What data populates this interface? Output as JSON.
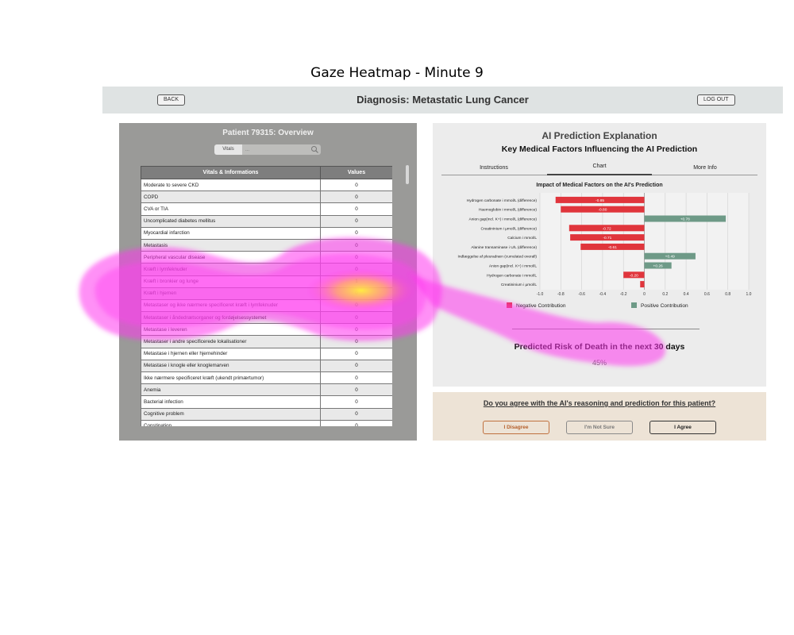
{
  "figure_title": "Gaze Heatmap - Minute 9",
  "header": {
    "back_label": "BACK",
    "title": "Diagnosis: Metastatic Lung Cancer",
    "logout_label": "LOG OUT"
  },
  "left": {
    "title": "Patient 79315: Overview",
    "search_tab": "Vitals",
    "search_placeholder": "...",
    "columns": [
      "Vitals & Informations",
      "Values"
    ],
    "rows": [
      [
        "Moderate to severe CKD",
        "0"
      ],
      [
        "COPD",
        "0"
      ],
      [
        "CVA or TIA",
        "0"
      ],
      [
        "Uncomplicated diabetes mellitus",
        "0"
      ],
      [
        "Myocardial infarction",
        "0"
      ],
      [
        "Metastasis",
        "0"
      ],
      [
        "Peripheral vascular disease",
        "0"
      ],
      [
        "Kræft i lymfeknuder",
        "0"
      ],
      [
        "Kræft i bronkier og lunge",
        "1"
      ],
      [
        "Kræft i hjernen",
        "0"
      ],
      [
        "Metastaser og ikke nærmere specificeret kræft i lymfeknuder",
        "0"
      ],
      [
        "Metastaser i åndedrætsorganer og fordøjelsessystemet",
        "0"
      ],
      [
        "Metastase i leveren",
        "0"
      ],
      [
        "Metastaser i andre specificerede lokalisationer",
        "0"
      ],
      [
        "Metastase i hjernen eller hjernehinder",
        "0"
      ],
      [
        "Metastase i knogle eller knoglemarven",
        "0"
      ],
      [
        "Ikke nærmere specificeret kræft (ukendt primærtumor)",
        "0"
      ],
      [
        "Anemia",
        "0"
      ],
      [
        "Bacterial infection",
        "0"
      ],
      [
        "Cognitive problem",
        "0"
      ],
      [
        "Constipation",
        "0"
      ]
    ]
  },
  "right": {
    "title": "AI Prediction Explanation",
    "subtitle": "Key Medical Factors Influencing the AI Prediction",
    "tabs": [
      "Instructions",
      "Chart",
      "More Info"
    ],
    "active_tab": "Chart",
    "risk_label": "Predicted Risk of Death in the next 30 days",
    "risk_value": "45%"
  },
  "question": {
    "text": "Do you agree with the AI's reasoning and prediction for this patient?",
    "disagree": "I Disagree",
    "not_sure": "I'm Not Sure",
    "agree": "I Agree"
  },
  "chart_data": {
    "type": "bar",
    "orientation": "horizontal",
    "title": "Impact of Medical Factors on the AI's Prediction",
    "categories": [
      "Hydrogen carbonate i mmol/L (difference)",
      "Haemoglobin i mmol/L (difference)",
      "Anion gap(incl. K+) i mmol/L (difference)",
      "Creatininium i µmol/L (difference)",
      "Calcium i mmol/L",
      "Alanine transaminase i U/L (difference)",
      "Indlæggelse af pleuradræn (cumulated overall)",
      "Anion gap(incl. K+) i mmol/L",
      "Hydrogen carbonate i mmol/L",
      "Creatininium i µmol/L"
    ],
    "values": [
      -0.85,
      -0.8,
      0.78,
      -0.72,
      -0.71,
      -0.61,
      0.49,
      0.26,
      -0.2,
      -0.04
    ],
    "value_labels": [
      "-0.85",
      "-0.80",
      "+0.78",
      "-0.72",
      "-0.71",
      "-0.61",
      "+0.49",
      "+0.26",
      "-0.20",
      ""
    ],
    "xlim": [
      -1.0,
      1.0
    ],
    "xticks": [
      "-1.0",
      "-0.8",
      "-0.6",
      "-0.4",
      "-0.2",
      "0",
      "0.2",
      "0.4",
      "0.6",
      "0.8",
      "1.0"
    ],
    "grid": true,
    "legend": [
      {
        "name": "Negative Contribution",
        "color": "#e0353c"
      },
      {
        "name": "Positive Contribution",
        "color": "#6e9a87"
      }
    ],
    "legend_position": "bottom"
  },
  "colors": {
    "negative": "#e0353c",
    "positive": "#6e9a87",
    "heat_outer": "#ff33ee",
    "heat_core": "#ffee33"
  }
}
